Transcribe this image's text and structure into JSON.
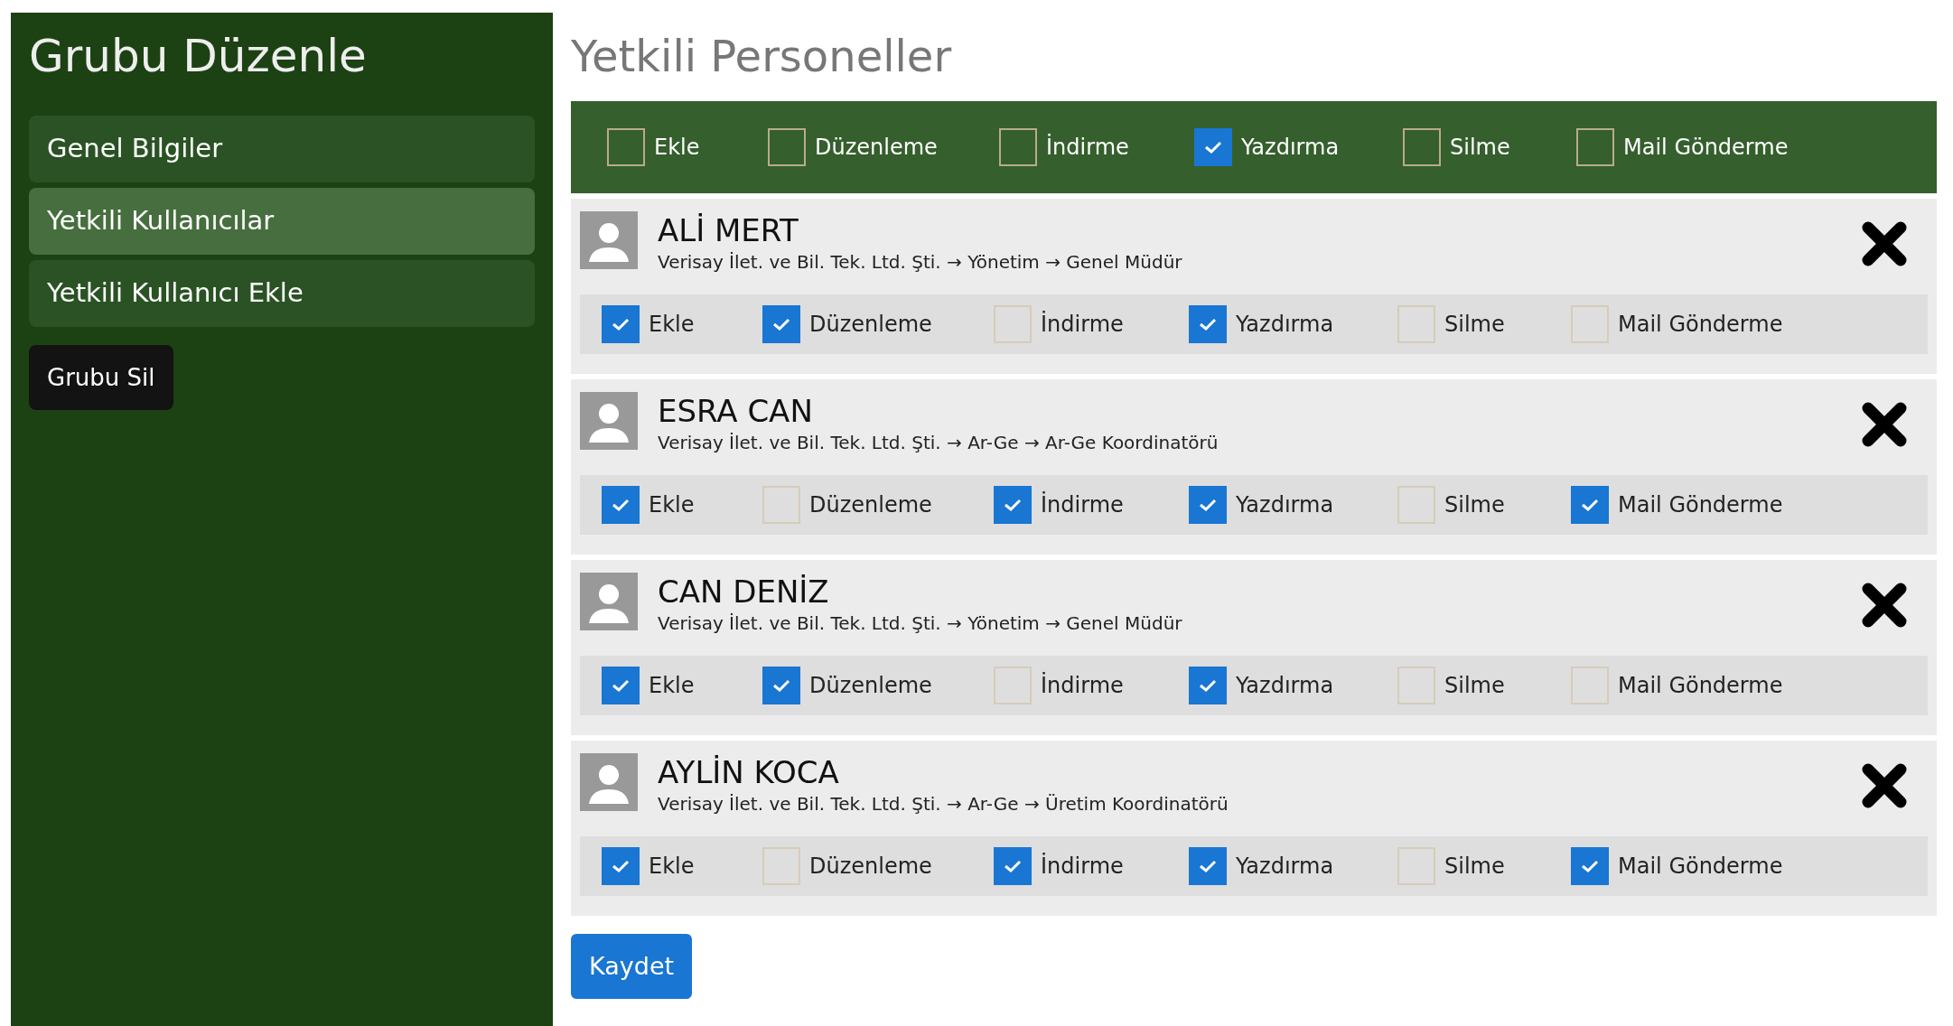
{
  "sidebar": {
    "title": "Grubu Düzenle",
    "items": [
      {
        "label": "Genel Bilgiler",
        "selected": false
      },
      {
        "label": "Yetkili Kullanıcılar",
        "selected": true
      },
      {
        "label": "Yetkili Kullanıcı Ekle",
        "selected": false
      }
    ],
    "delete_button": "Grubu Sil"
  },
  "main": {
    "title": "Yetkili Personeller",
    "header_permissions": [
      {
        "label": "Ekle",
        "checked": false
      },
      {
        "label": "Düzenleme",
        "checked": false
      },
      {
        "label": "İndirme",
        "checked": false
      },
      {
        "label": "Yazdırma",
        "checked": true
      },
      {
        "label": "Silme",
        "checked": false
      },
      {
        "label": "Mail Gönderme",
        "checked": false
      }
    ],
    "users": [
      {
        "name": "ALİ MERT",
        "path": "Verisay İlet. ve Bil. Tek. Ltd. Şti. → Yönetim → Genel Müdür",
        "permissions": [
          {
            "label": "Ekle",
            "checked": true
          },
          {
            "label": "Düzenleme",
            "checked": true
          },
          {
            "label": "İndirme",
            "checked": false
          },
          {
            "label": "Yazdırma",
            "checked": true
          },
          {
            "label": "Silme",
            "checked": false
          },
          {
            "label": "Mail Gönderme",
            "checked": false
          }
        ]
      },
      {
        "name": "ESRA CAN",
        "path": "Verisay İlet. ve Bil. Tek. Ltd. Şti. → Ar-Ge → Ar-Ge Koordinatörü",
        "permissions": [
          {
            "label": "Ekle",
            "checked": true
          },
          {
            "label": "Düzenleme",
            "checked": false
          },
          {
            "label": "İndirme",
            "checked": true
          },
          {
            "label": "Yazdırma",
            "checked": true
          },
          {
            "label": "Silme",
            "checked": false
          },
          {
            "label": "Mail Gönderme",
            "checked": true
          }
        ]
      },
      {
        "name": "CAN DENİZ",
        "path": "Verisay İlet. ve Bil. Tek. Ltd. Şti. → Yönetim → Genel Müdür",
        "permissions": [
          {
            "label": "Ekle",
            "checked": true
          },
          {
            "label": "Düzenleme",
            "checked": true
          },
          {
            "label": "İndirme",
            "checked": false
          },
          {
            "label": "Yazdırma",
            "checked": true
          },
          {
            "label": "Silme",
            "checked": false
          },
          {
            "label": "Mail Gönderme",
            "checked": false
          }
        ]
      },
      {
        "name": "AYLİN KOCA",
        "path": "Verisay İlet. ve Bil. Tek. Ltd. Şti. → Ar-Ge → Üretim Koordinatörü",
        "permissions": [
          {
            "label": "Ekle",
            "checked": true
          },
          {
            "label": "Düzenleme",
            "checked": false
          },
          {
            "label": "İndirme",
            "checked": true
          },
          {
            "label": "Yazdırma",
            "checked": true
          },
          {
            "label": "Silme",
            "checked": false
          },
          {
            "label": "Mail Gönderme",
            "checked": true
          }
        ]
      }
    ],
    "save_button": "Kaydet"
  }
}
